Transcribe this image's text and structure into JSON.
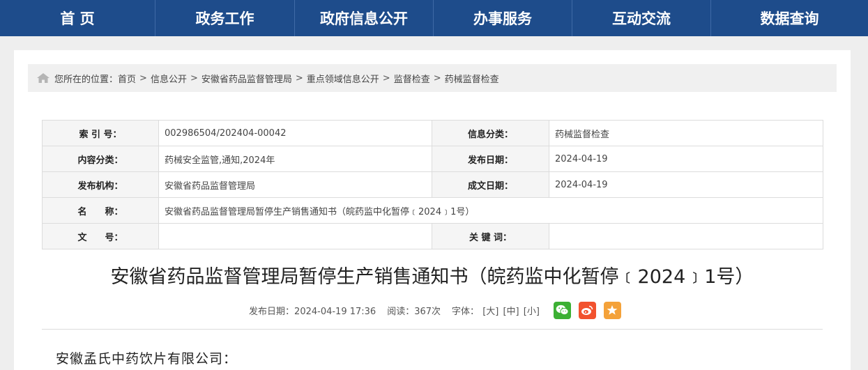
{
  "nav": [
    {
      "label": "首 页"
    },
    {
      "label": "政务工作"
    },
    {
      "label": "政府信息公开"
    },
    {
      "label": "办事服务"
    },
    {
      "label": "互动交流"
    },
    {
      "label": "数据查询"
    }
  ],
  "breadcrumb": {
    "prefix": "您所在的位置：",
    "items": [
      "首页",
      "信息公开",
      "安徽省药品监督管理局",
      "重点领域信息公开",
      "监督检查",
      "药械监督检查"
    ],
    "separator": ">"
  },
  "meta": {
    "index_label": "索 引 号：",
    "index_value": "002986504/202404-00042",
    "category_label": "信息分类：",
    "category_value": "药械监督检查",
    "content_label": "内容分类：",
    "content_value": "药械安全监管,通知,2024年",
    "publish_date_label": "发布日期：",
    "publish_date_value": "2024-04-19",
    "org_label": "发布机构：",
    "org_value": "安徽省药品监督管理局",
    "create_date_label": "成文日期：",
    "create_date_value": "2024-04-19",
    "name_label": "名　　称：",
    "name_value": "安徽省药品监督管理局暂停生产销售通知书（皖药监中化暂停﹝2024﹞1号）",
    "doc_no_label": "文　　号：",
    "doc_no_value": "",
    "keywords_label": "关 键 词：",
    "keywords_value": ""
  },
  "article": {
    "title": "安徽省药品监督管理局暂停生产销售通知书（皖药监中化暂停﹝2024﹞1号）",
    "publish_info": "发布日期：2024-04-19 17:36",
    "views": "阅读：367次",
    "font_label": "字体：",
    "font_large": "[大]",
    "font_medium": "[中]",
    "font_small": "[小]",
    "salutation": "安徽孟氏中药饮片有限公司："
  },
  "share_icons": [
    "wechat-icon",
    "weibo-icon",
    "favorite-icon"
  ],
  "colors": {
    "nav_bg": "#1e4c8b",
    "wechat": "#3cb034",
    "weibo": "#f2522e",
    "favorite": "#f4a23a"
  }
}
